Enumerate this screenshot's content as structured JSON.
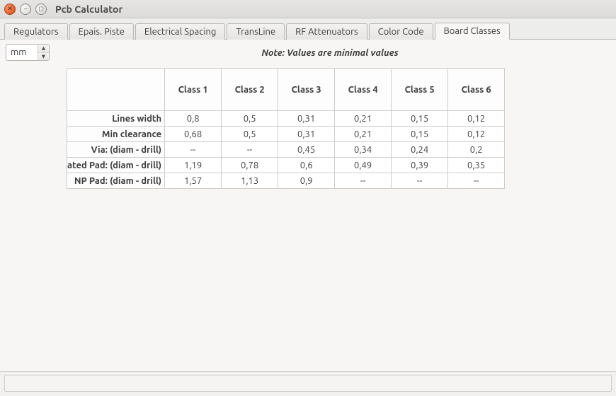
{
  "window": {
    "title": "Pcb Calculator"
  },
  "tabs": [
    {
      "label": "Regulators"
    },
    {
      "label": "Epais. Piste"
    },
    {
      "label": "Electrical Spacing"
    },
    {
      "label": "TransLine"
    },
    {
      "label": "RF Attenuators"
    },
    {
      "label": "Color Code"
    },
    {
      "label": "Board Classes",
      "active": true
    }
  ],
  "unit_selector": {
    "value": "mm"
  },
  "note": "Note: Values are minimal values",
  "table": {
    "columns": [
      "Class 1",
      "Class 2",
      "Class 3",
      "Class 4",
      "Class 5",
      "Class 6"
    ],
    "rows": [
      {
        "label": "Lines width",
        "cells": [
          "0,8",
          "0,5",
          "0,31",
          "0,21",
          "0,15",
          "0,12"
        ]
      },
      {
        "label": "Min clearance",
        "cells": [
          "0,68",
          "0,5",
          "0,31",
          "0,21",
          "0,15",
          "0,12"
        ]
      },
      {
        "label": "Via: (diam - drill)",
        "cells": [
          "--",
          "--",
          "0,45",
          "0,34",
          "0,24",
          "0,2"
        ]
      },
      {
        "label": "ated Pad: (diam - drill)",
        "cells": [
          "1,19",
          "0,78",
          "0,6",
          "0,49",
          "0,39",
          "0,35"
        ]
      },
      {
        "label": "NP Pad: (diam - drill)",
        "cells": [
          "1,57",
          "1,13",
          "0,9",
          "--",
          "--",
          "--"
        ]
      }
    ]
  }
}
